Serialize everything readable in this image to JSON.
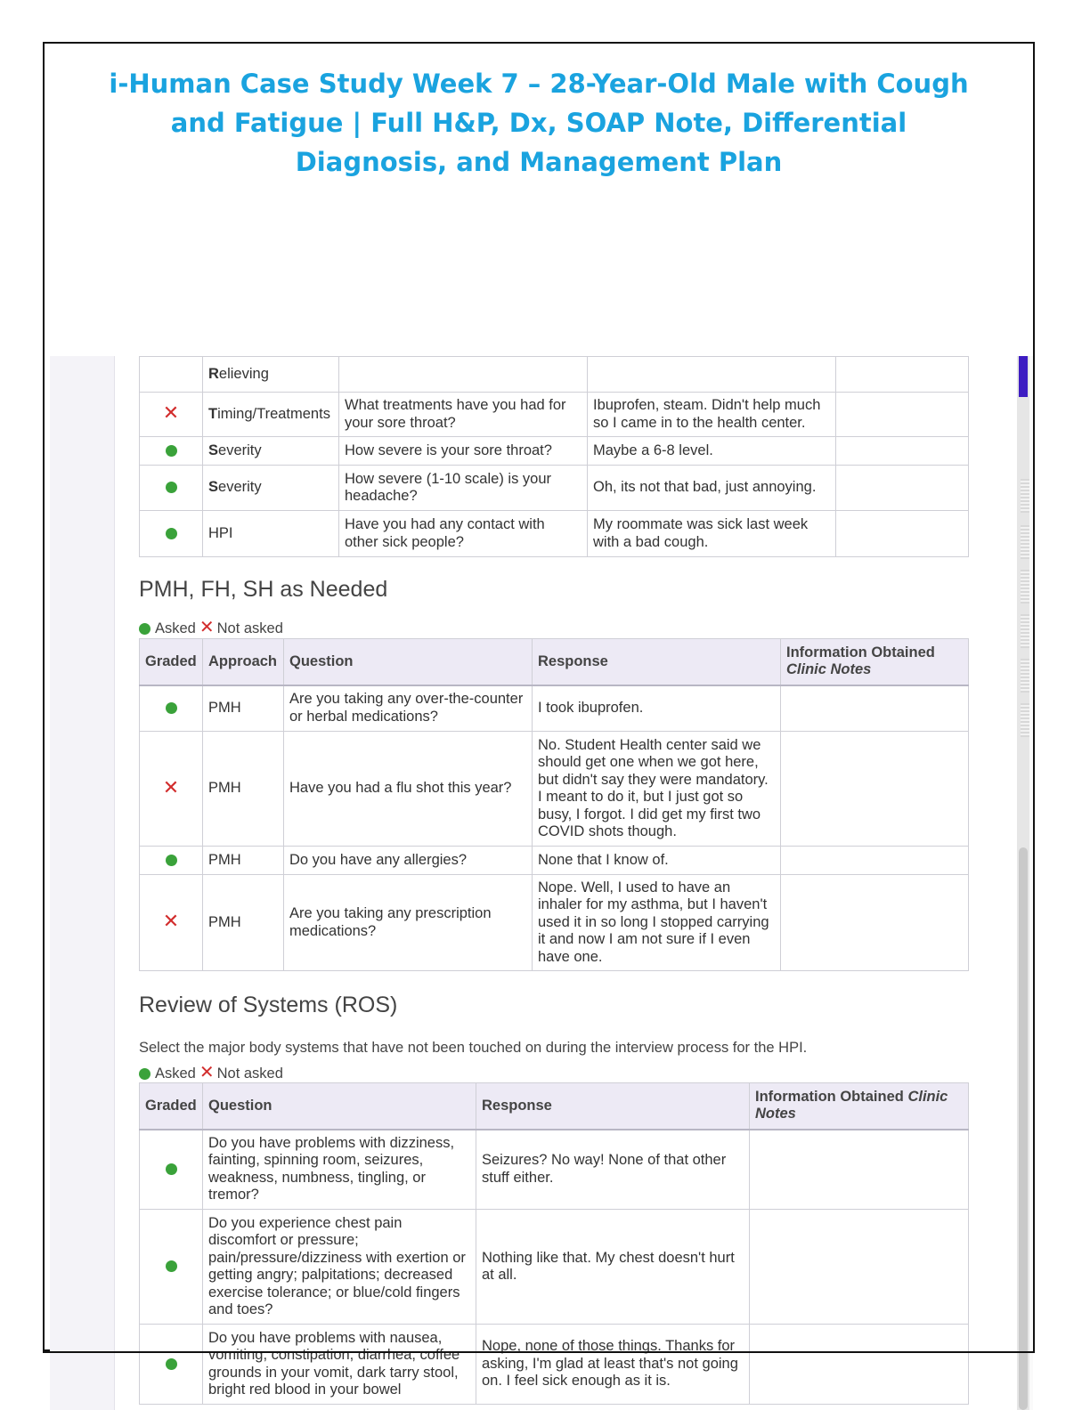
{
  "document_title": "i-Human Case Study Week 7 – 28-Year-Old Male with Cough and Fatigue | Full H&P, Dx, SOAP Note, Differential Diagnosis, and Management Plan",
  "icons": {
    "asked": "green-dot-icon",
    "not_asked": "red-x-icon",
    "x_glyph": "✕"
  },
  "colors": {
    "title": "#1aa3df",
    "asked": "#3aa23a",
    "not_asked": "#d22d2d",
    "header_bg": "#edeaf5"
  },
  "hpi_table": {
    "rows": [
      {
        "status": "",
        "first": "R",
        "rest": "elieving",
        "question": "",
        "response": ""
      },
      {
        "status": "not_asked",
        "first": "T",
        "rest": "iming/Treatments",
        "question": "What treatments have you had for your sore throat?",
        "response": "Ibuprofen, steam. Didn't help much so I came in to the health center."
      },
      {
        "status": "asked",
        "first": "S",
        "rest": "everity",
        "question": "How severe is your sore throat?",
        "response": "Maybe a 6-8 level."
      },
      {
        "status": "asked",
        "first": "S",
        "rest": "everity",
        "question": "How severe (1-10 scale) is your headache?",
        "response": "Oh, its not that bad, just annoying."
      },
      {
        "status": "asked",
        "first": "",
        "rest": "HPI",
        "question": "Have you had any contact with other sick people?",
        "response": "My roommate was sick last week with a bad cough."
      }
    ]
  },
  "pmh_section": {
    "heading": "PMH, FH, SH as Needed",
    "legend_asked": "Asked",
    "legend_not_asked": "Not asked",
    "headers": {
      "graded": "Graded",
      "approach": "Approach",
      "question": "Question",
      "response": "Response",
      "info": "Information Obtained",
      "notes": "Clinic Notes"
    },
    "rows": [
      {
        "status": "asked",
        "approach": "PMH",
        "question": "Are you taking any over-the-counter or herbal medications?",
        "response": "I took ibuprofen."
      },
      {
        "status": "not_asked",
        "approach": "PMH",
        "question": "Have you had a flu shot this year?",
        "response": "No. Student Health center said we should get one when we got here, but didn't say they were mandatory. I meant to do it, but I just got so busy, I forgot. I did get my first two COVID shots though."
      },
      {
        "status": "asked",
        "approach": "PMH",
        "question": "Do you have any allergies?",
        "response": "None that I know of."
      },
      {
        "status": "not_asked",
        "approach": "PMH",
        "question": "Are you taking any prescription medications?",
        "response": "Nope. Well, I used to have an inhaler for my asthma, but I haven't used it in so long I stopped carrying it and now I am not sure if I even have one."
      }
    ]
  },
  "ros_section": {
    "heading": "Review of Systems (ROS)",
    "instruction": "Select the major body systems that have not been touched on during the interview process for the HPI.",
    "legend_asked": "Asked",
    "legend_not_asked": "Not asked",
    "headers": {
      "graded": "Graded",
      "question": "Question",
      "response": "Response",
      "info": "Information Obtained",
      "clinic": "Clinic",
      "notes": "Notes"
    },
    "rows": [
      {
        "status": "asked",
        "question": "Do you have problems with dizziness, fainting, spinning room, seizures, weakness, numbness, tingling, or tremor?",
        "response": "Seizures? No way! None of that other stuff either."
      },
      {
        "status": "asked",
        "question": "Do you experience chest pain discomfort or pressure; pain/pressure/dizziness with exertion or getting angry; palpitations; decreased exercise tolerance; or blue/cold fingers and toes?",
        "response": "Nothing like that. My chest doesn't hurt at all."
      },
      {
        "status": "asked",
        "question": "Do you have problems with nausea, vomiting, constipation, diarrhea, coffee grounds in your vomit, dark tarry stool, bright red blood in your bowel",
        "response": "Nope, none of those things. Thanks for asking, I'm glad at least that's not going on. I feel sick enough as it is."
      }
    ]
  }
}
